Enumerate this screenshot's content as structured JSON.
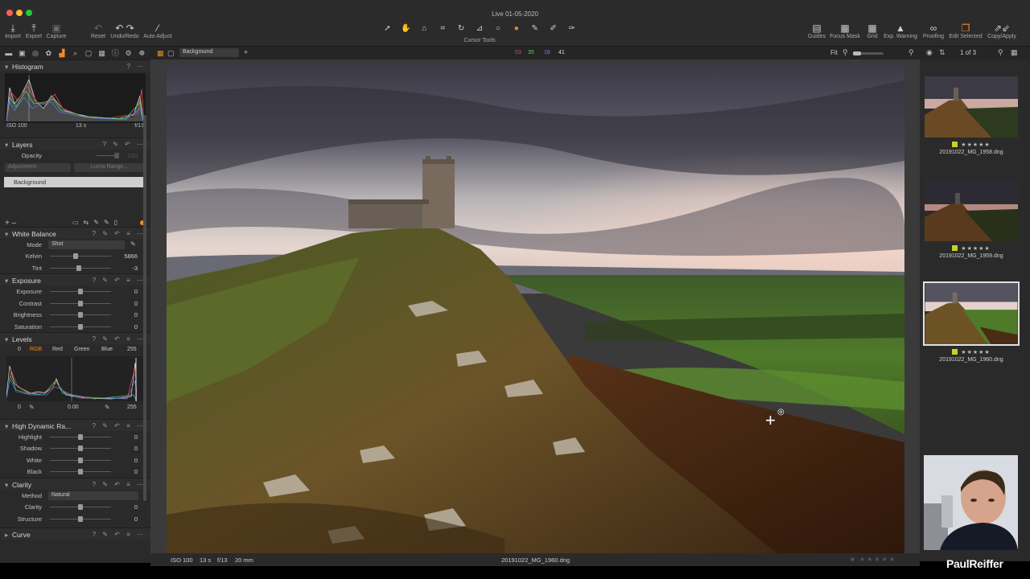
{
  "window": {
    "title": "Live 01-05-2020"
  },
  "toolbar": {
    "left": [
      {
        "label": "Import",
        "icon": "import-icon"
      },
      {
        "label": "Export",
        "icon": "export-icon"
      },
      {
        "label": "Capture",
        "icon": "camera-icon"
      },
      {
        "label": "Reset",
        "icon": "reset-icon"
      },
      {
        "label": "Undo/Redo",
        "icon": "undo-icon"
      },
      {
        "label": "Auto Adjust",
        "icon": "magic-wand-icon"
      }
    ],
    "cursor_tools_label": "Cursor Tools",
    "right": [
      {
        "label": "Guides",
        "icon": "guides-icon"
      },
      {
        "label": "Focus Mask",
        "icon": "focus-mask-icon"
      },
      {
        "label": "Grid",
        "icon": "grid-icon"
      },
      {
        "label": "Exp. Warning",
        "icon": "warning-icon"
      },
      {
        "label": "Proofing",
        "icon": "proofing-icon"
      },
      {
        "label": "Edit Selected",
        "icon": "edit-selected-icon"
      },
      {
        "label": "Copy/Apply",
        "icon": "copy-apply-icon"
      }
    ]
  },
  "viewer_bar": {
    "layer_select": "Background",
    "readout": {
      "r": "53",
      "g": "35",
      "b": "16",
      "l": "41"
    },
    "zoom": "Fit",
    "page": "1 of 3"
  },
  "histogram": {
    "title": "Histogram",
    "iso": "ISO 100",
    "shutter": "13 s",
    "aperture": "f/13"
  },
  "layers": {
    "title": "Layers",
    "opacity_label": "Opacity",
    "opacity_value": "100",
    "adjustment": "Adjustment",
    "luma_range": "Luma Range...",
    "items": [
      "Background"
    ]
  },
  "white_balance": {
    "title": "White Balance",
    "mode_label": "Mode",
    "mode_value": "Shot",
    "rows": [
      {
        "label": "Kelvin",
        "value": "5866",
        "level": 0.42
      },
      {
        "label": "Tint",
        "value": "-3",
        "level": 0.48
      }
    ]
  },
  "exposure": {
    "title": "Exposure",
    "rows": [
      {
        "label": "Exposure",
        "value": "0",
        "level": 0.5
      },
      {
        "label": "Contrast",
        "value": "0",
        "level": 0.5
      },
      {
        "label": "Brightness",
        "value": "0",
        "level": 0.5
      },
      {
        "label": "Saturation",
        "value": "0",
        "level": 0.5
      }
    ]
  },
  "levels": {
    "title": "Levels",
    "left": "0",
    "channels": [
      "RGB",
      "Red",
      "Green",
      "Blue"
    ],
    "right": "255",
    "min": "0",
    "mid": "0.00",
    "max": "255"
  },
  "hdr": {
    "title": "High Dynamic Ra...",
    "rows": [
      {
        "label": "Highlight",
        "value": "0",
        "level": 0.5
      },
      {
        "label": "Shadow",
        "value": "0",
        "level": 0.5
      },
      {
        "label": "White",
        "value": "0",
        "level": 0.5
      },
      {
        "label": "Black",
        "value": "0",
        "level": 0.5
      }
    ]
  },
  "clarity": {
    "title": "Clarity",
    "method_label": "Method",
    "method_value": "Natural",
    "rows": [
      {
        "label": "Clarity",
        "value": "0",
        "level": 0.5
      },
      {
        "label": "Structure",
        "value": "0",
        "level": 0.5
      }
    ]
  },
  "curve": {
    "title": "Curve"
  },
  "status": {
    "iso": "ISO 100",
    "shutter": "13 s",
    "aperture": "f/13",
    "focal": "20 mm",
    "filename": "20191022_MG_1960.dng"
  },
  "thumbnails": [
    {
      "filename": "20191022_MG_1958.dng",
      "rating": "★★★★★",
      "selected": false
    },
    {
      "filename": "20191022_MG_1959.dng",
      "rating": "★★★★★",
      "selected": false
    },
    {
      "filename": "20191022_MG_1960.dng",
      "rating": "★★★★★",
      "selected": true
    }
  ],
  "brand": {
    "name": "PaulReiffer"
  },
  "colors": {
    "accent": "#f08a2a",
    "tag_yellow": "#c8d02a",
    "panel": "#2a2a2a"
  }
}
